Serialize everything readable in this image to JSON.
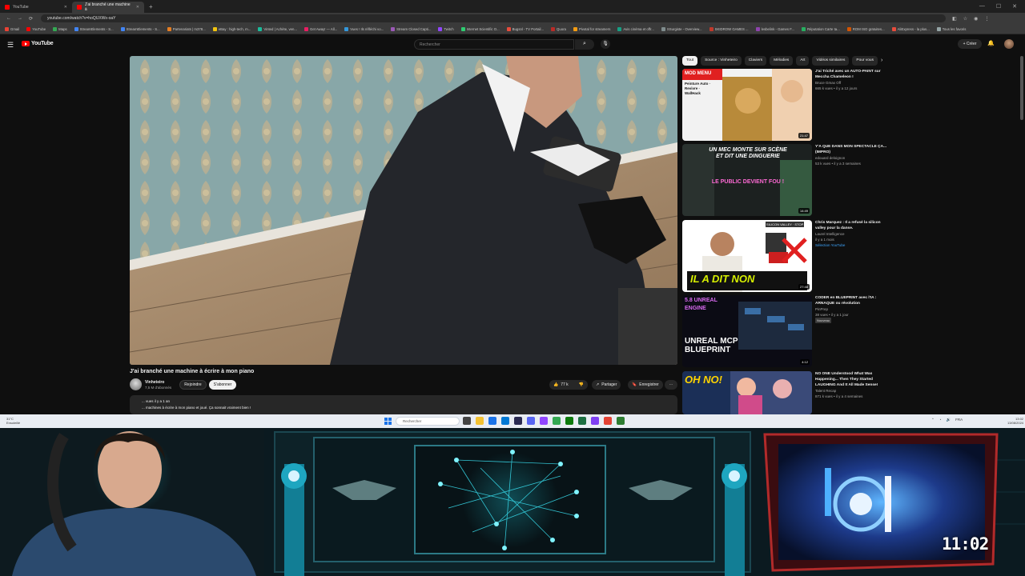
{
  "browser": {
    "tabs": [
      {
        "title": "YouTube",
        "active": false
      },
      {
        "title": "J'ai branché une machine à",
        "active": true
      }
    ],
    "url": "youtube.com/watch?v=hoQUXWx-oaY",
    "bookmarks": [
      "Gmail",
      "YouTube",
      "Maps",
      "StreamElements - S...",
      "StreamElements - S...",
      "Partenariats | m378...",
      "eBay : high-tech, m...",
      "Vinted | Achète, ven...",
      "Get Away! — All...",
      "Vues ! Ils réfléchi vo...",
      "Stream Closed Capti...",
      "Twitch",
      "Internet Scientific O...",
      "Bugsnl - TV Portail...",
      "Quora",
      "Pivotal for streamers",
      "Avis cinéma et offr...",
      "SSurgiste - Overview...",
      "SKIDROW GAMES ...",
      "lesbelink - Games F...",
      "Réputation Carte ta...",
      "ROM ISO gratuites...",
      "AliExpress - la plus...",
      "Tous les favoris"
    ]
  },
  "youtube": {
    "logo": "YouTube",
    "search_placeholder": "Rechercher",
    "create_label": "+ Créer",
    "video_title": "J'ai branché une machine à écrire à mon piano",
    "channel": {
      "name": "Vinheteiro",
      "subs": "7,5 M d'abonnés"
    },
    "join_label": "Rejoindre",
    "subscribe_label": "S'abonner",
    "likes": "77 k",
    "share_label": "Partager",
    "save_label": "Enregistrer",
    "description": {
      "line1": "... vues  il y a 1 an",
      "line2": "... machines à écrire à mon piano et joué. Ça sonnait vraiment bien !"
    },
    "chips": [
      "Tout",
      "Source : Vinheteiro",
      "Claviers",
      "Mélodies",
      "Art",
      "Vidéos similaires",
      "Pour vous"
    ],
    "recommendations": [
      {
        "title": "J'ai Triché avec un AUTO-PAINT sur Meccha Chameleon !",
        "channel": "Bruce Gmax Off",
        "stats": "665 k vues • il y a 12 jours",
        "duration": "21:47",
        "thumb_text": "MOD MENU",
        "thumb_sub": "Peinture Auto · Revivre · WallHack"
      },
      {
        "title": "Y'A QUE DANS MON SPECTACLE ÇA... (IMPRO)",
        "channel": "edouard deloignon",
        "stats": "53 k vues • il y a 3 semaines",
        "duration": "14:49",
        "thumb_text": "UN MEC MONTE SUR SCÈNE ET DIT UNE DINGUERIE",
        "thumb_sub": "LE PUBLIC DEVIENT FOU !"
      },
      {
        "title": "Chris Marquez : Il a refusé la silicon valley pour la danse.",
        "channel": "Laurel Intelligence",
        "stats": "il y a 1 mois",
        "extra": "Sélection YouTube",
        "duration": "27:48",
        "thumb_text": "IL A DIT NON",
        "thumb_sub": "SILICON VALLEY · STOP"
      },
      {
        "title": "CODER en BLUEPRINT avec l'IA : ARNAQUE ou révolution",
        "channel": "PinPrep",
        "stats": "38 vues • il y a 1 jour",
        "extra": "Nouveau",
        "duration": "4:12",
        "thumb_text": "UNREAL MCP BLUEPRINT",
        "thumb_sub": "5.8 UNREAL ENGINE"
      },
      {
        "title": "NO ONE Understood What Was Happening... Then They Started LAUGHING And It All Made Sense!",
        "channel": "Talent Recap",
        "stats": "871 k vues • il y a 4 semaines",
        "thumb_text": "OH NO!"
      }
    ]
  },
  "taskbar": {
    "weather": {
      "temp": "31°C",
      "cond": "Ensoleillé"
    },
    "search_placeholder": "Rechercher",
    "tray_lang": "FRA",
    "time": "13:02",
    "date": "13/08/2024"
  },
  "stream": {
    "timer": "11:02"
  },
  "colors": {
    "yt_red": "#ff0000",
    "bg": "#0f0f0f",
    "chip_bg": "#272727",
    "accent": "#3ea6ff",
    "teal": "#1fb9c9"
  }
}
